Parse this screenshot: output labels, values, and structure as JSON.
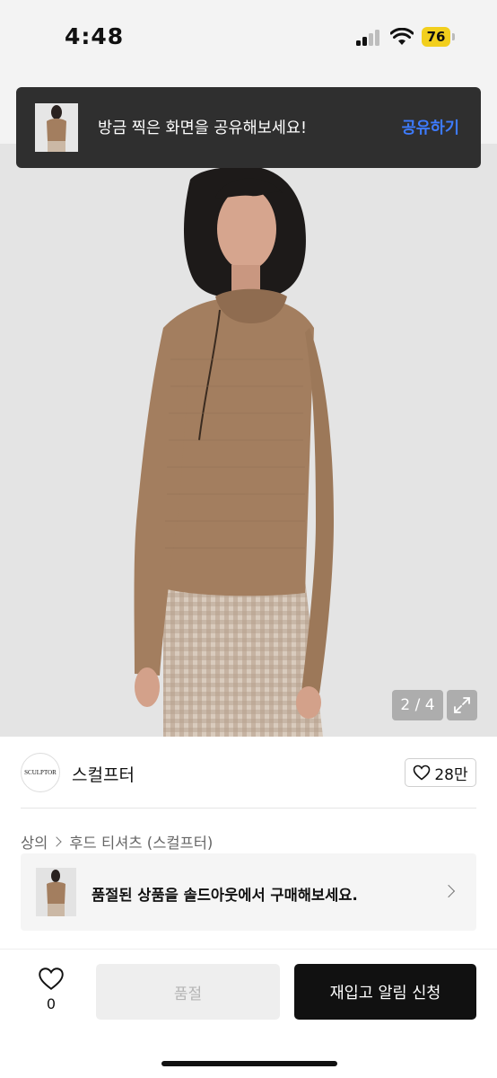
{
  "status_bar": {
    "time": "4:48",
    "battery": "76"
  },
  "toast": {
    "message": "방금 찍은 화면을 공유해보세요!",
    "action": "공유하기"
  },
  "gallery": {
    "counter": "2 / 4"
  },
  "brand": {
    "logo_text": "SCULPTOR",
    "name": "스컬프터",
    "like_count": "28만"
  },
  "breadcrumb": {
    "category": "상의",
    "subcategory": "후드 티셔츠 (스컬프터)"
  },
  "soldout_banner": {
    "text": "품절된 상품을 솔드아웃에서 구매해보세요."
  },
  "bottom_bar": {
    "wish_count": "0",
    "soldout_label": "품절",
    "restock_label": "재입고 알림 신청"
  },
  "colors": {
    "accent_blue": "#3d7bff",
    "toast_bg": "#2f2f2f",
    "primary_button": "#111111",
    "battery": "#f2cf1d"
  }
}
